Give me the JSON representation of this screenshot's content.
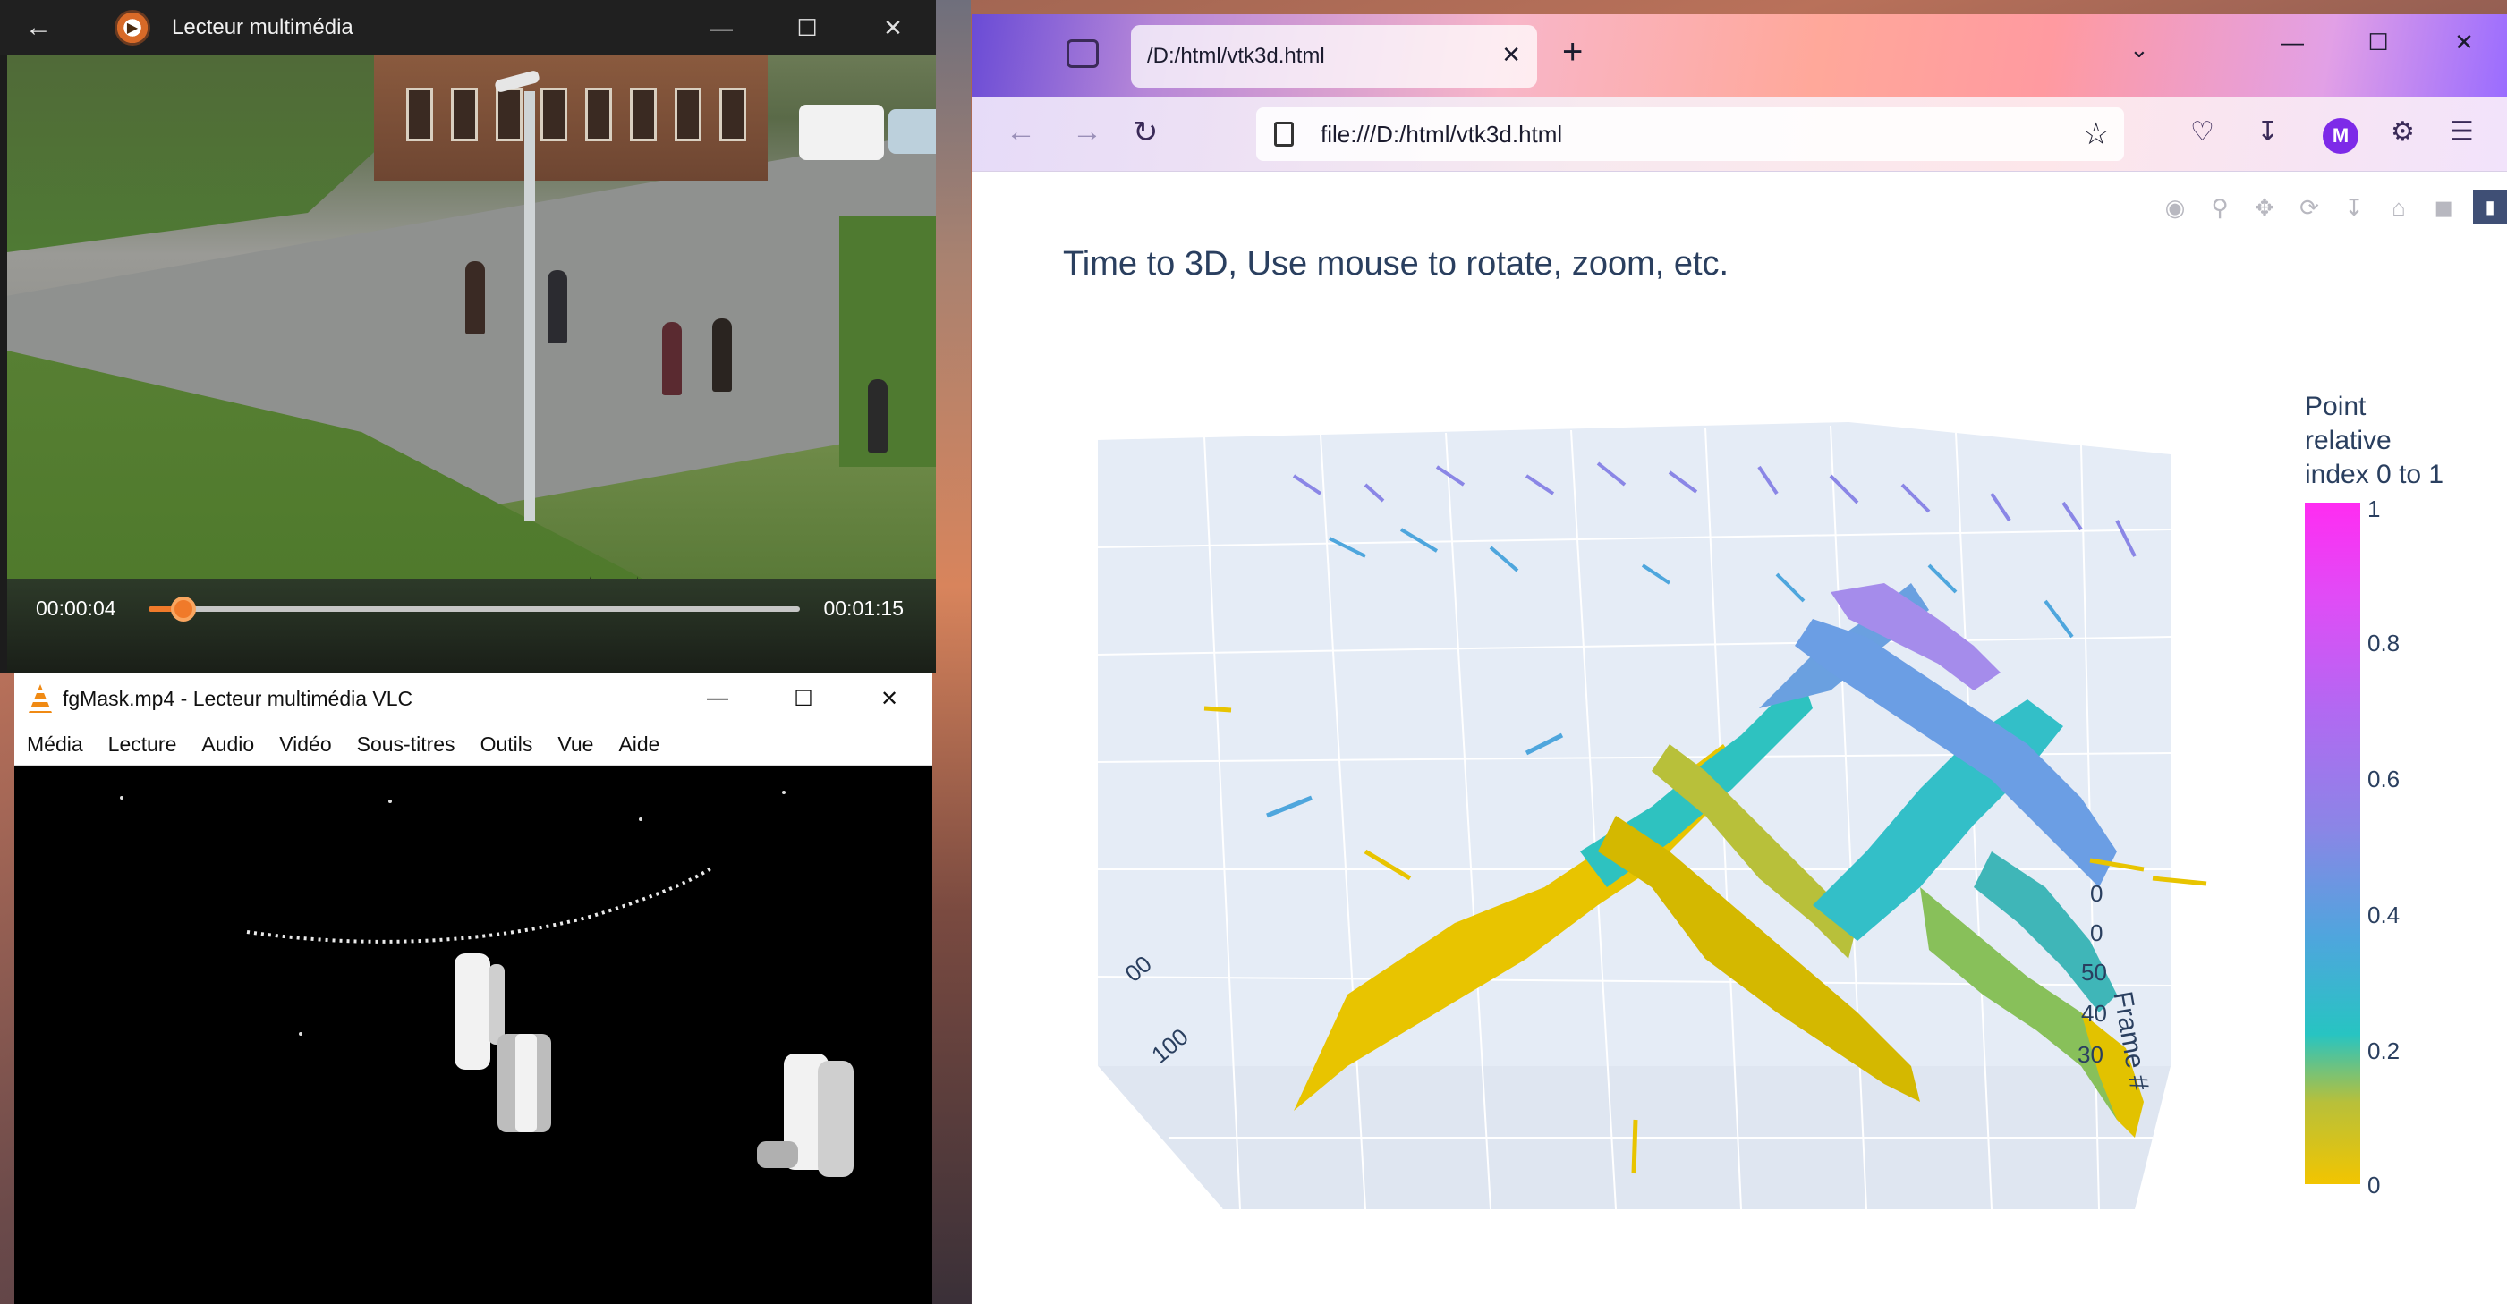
{
  "media_player": {
    "title": "Lecteur multimédia",
    "back_icon": "arrow-left-icon",
    "time_current": "00:00:04",
    "time_total": "00:01:15",
    "progress_fraction": 0.053
  },
  "vlc": {
    "title": "fgMask.mp4 - Lecteur multimédia VLC",
    "menu": [
      "Média",
      "Lecture",
      "Audio",
      "Vidéo",
      "Sous-titres",
      "Outils",
      "Vue",
      "Aide"
    ]
  },
  "window_controls": {
    "minimize": "—",
    "maximize": "☐",
    "close": "✕"
  },
  "browser": {
    "tab_title": "/D:/html/vtk3d.html",
    "url": "file:///D:/html/vtk3d.html",
    "avatar_letter": "M",
    "accent": "#7d2ae8"
  },
  "plot": {
    "title": "Time to 3D, Use mouse to rotate, zoom, etc.",
    "colorbar_title": [
      "Point",
      "relative",
      "index 0 to 1"
    ],
    "colorbar_ticks": [
      "1",
      "0.8",
      "0.6",
      "0.4",
      "0.2",
      "0"
    ],
    "frame_axis_title": "Frame #",
    "frame_axis_ticks": [
      "0",
      "0",
      "50",
      "40",
      "30"
    ],
    "left_axis_ticks": [
      "00",
      "100"
    ],
    "colorscale": [
      "#f2c500",
      "#27c4c2",
      "#4ea6dd",
      "#8a86e6",
      "#b368f2",
      "#ff2cf2"
    ]
  }
}
